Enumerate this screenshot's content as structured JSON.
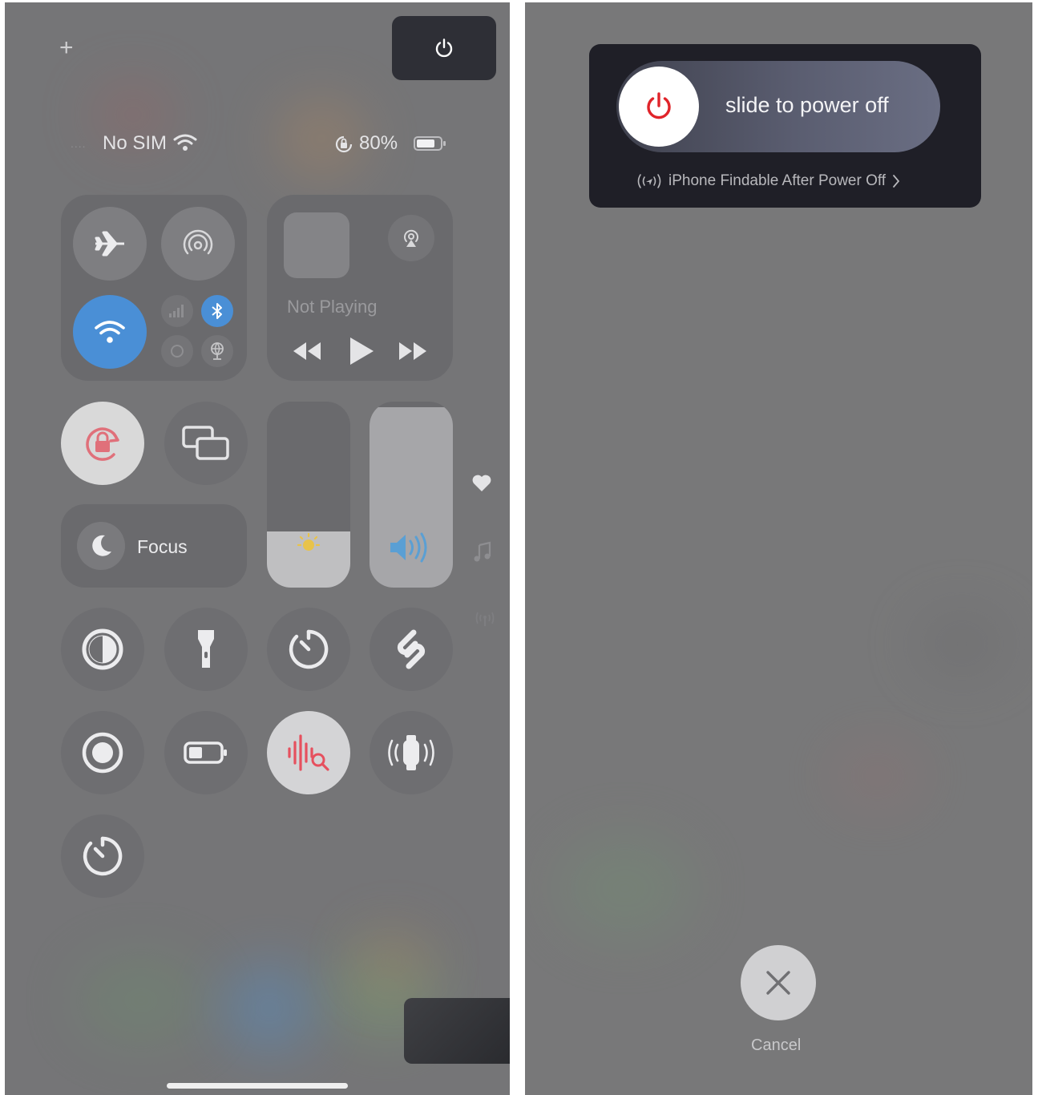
{
  "control_center": {
    "add_label": "+",
    "status_bar": {
      "carrier": "No SIM",
      "battery_percent": "80%",
      "battery_level": 0.8
    },
    "now_playing": {
      "status": "Not Playing"
    },
    "focus": {
      "label": "Focus"
    },
    "brightness_level": 0.3,
    "volume_level": 0.97,
    "colors": {
      "wifi_active": "#4a8fd6",
      "bluetooth_active": "#4a8fd6",
      "lock_active": "#d9d9d9",
      "sound_recognition": "#e6505e",
      "accent_red": "#e0242a"
    }
  },
  "power_off": {
    "slider_label": "slide to power off",
    "findable_text": "iPhone Findable After Power Off",
    "cancel_label": "Cancel"
  }
}
